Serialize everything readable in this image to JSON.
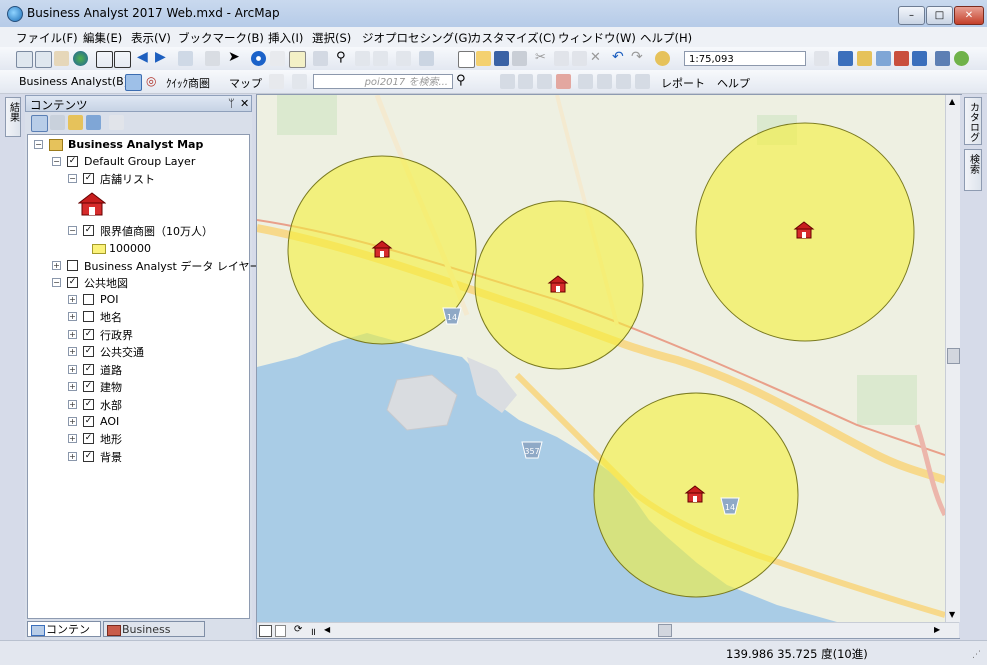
{
  "window": {
    "title": "Business Analyst 2017 Web.mxd - ArcMap",
    "minimize": "–",
    "maximize": "□",
    "close": "✕"
  },
  "menus": [
    "ファイル(F)",
    "編集(E)",
    "表示(V)",
    "ブックマーク(B)",
    "挿入(I)",
    "選択(S)",
    "ジオプロセシング(G)",
    "カスタマイズ(C)",
    "ウィンドウ(W)",
    "ヘルプ(H)"
  ],
  "toolbar1": {
    "scale": "1:75,093"
  },
  "toolbar2": {
    "business_analyst": "Business Analyst(B)",
    "quick_area": "ｸｲｯｸ商圏",
    "map_menu": "マップ",
    "search_placeholder": "poi2017 を検索...",
    "report": "レポート",
    "help": "ヘルプ"
  },
  "toc": {
    "title": "コンテンツ",
    "pin": "ᛘ",
    "close": "✕",
    "map_name": "Business Analyst Map",
    "layers": [
      {
        "label": "Default Group Layer",
        "checked": true,
        "expand": "−"
      },
      {
        "label": "店舗リスト",
        "checked": true,
        "expand": "−"
      },
      {
        "label": "限界値商圏（10万人）",
        "checked": true,
        "expand": "−"
      },
      {
        "label": "100000"
      },
      {
        "label": "Business Analyst データ レイヤー",
        "checked": false,
        "expand": "+"
      },
      {
        "label": "公共地図",
        "checked": true,
        "expand": "−"
      },
      {
        "label": "POI",
        "checked": false,
        "expand": "+"
      },
      {
        "label": "地名",
        "checked": false,
        "expand": "+"
      },
      {
        "label": "行政界",
        "checked": true,
        "expand": "+"
      },
      {
        "label": "公共交通",
        "checked": true,
        "expand": "+"
      },
      {
        "label": "道路",
        "checked": true,
        "expand": "+"
      },
      {
        "label": "建物",
        "checked": true,
        "expand": "+"
      },
      {
        "label": "水部",
        "checked": true,
        "expand": "+"
      },
      {
        "label": "AOI",
        "checked": true,
        "expand": "+"
      },
      {
        "label": "地形",
        "checked": true,
        "expand": "+"
      },
      {
        "label": "背景",
        "checked": true,
        "expand": "+"
      }
    ],
    "tabs": [
      "コンテンツ",
      "Business Analyst"
    ]
  },
  "side_tabs": {
    "left": "結果",
    "right_catalog": "カタログ",
    "right_search": "検索"
  },
  "map": {
    "route_labels": [
      "14",
      "357",
      "14"
    ]
  },
  "status": {
    "coords": "139.986  35.725 度(10進)"
  },
  "colors": {
    "buffer_fill": "#f5f03a",
    "water": "#a9cce6",
    "land": "#eef0e2",
    "road": "#f7d98b"
  }
}
